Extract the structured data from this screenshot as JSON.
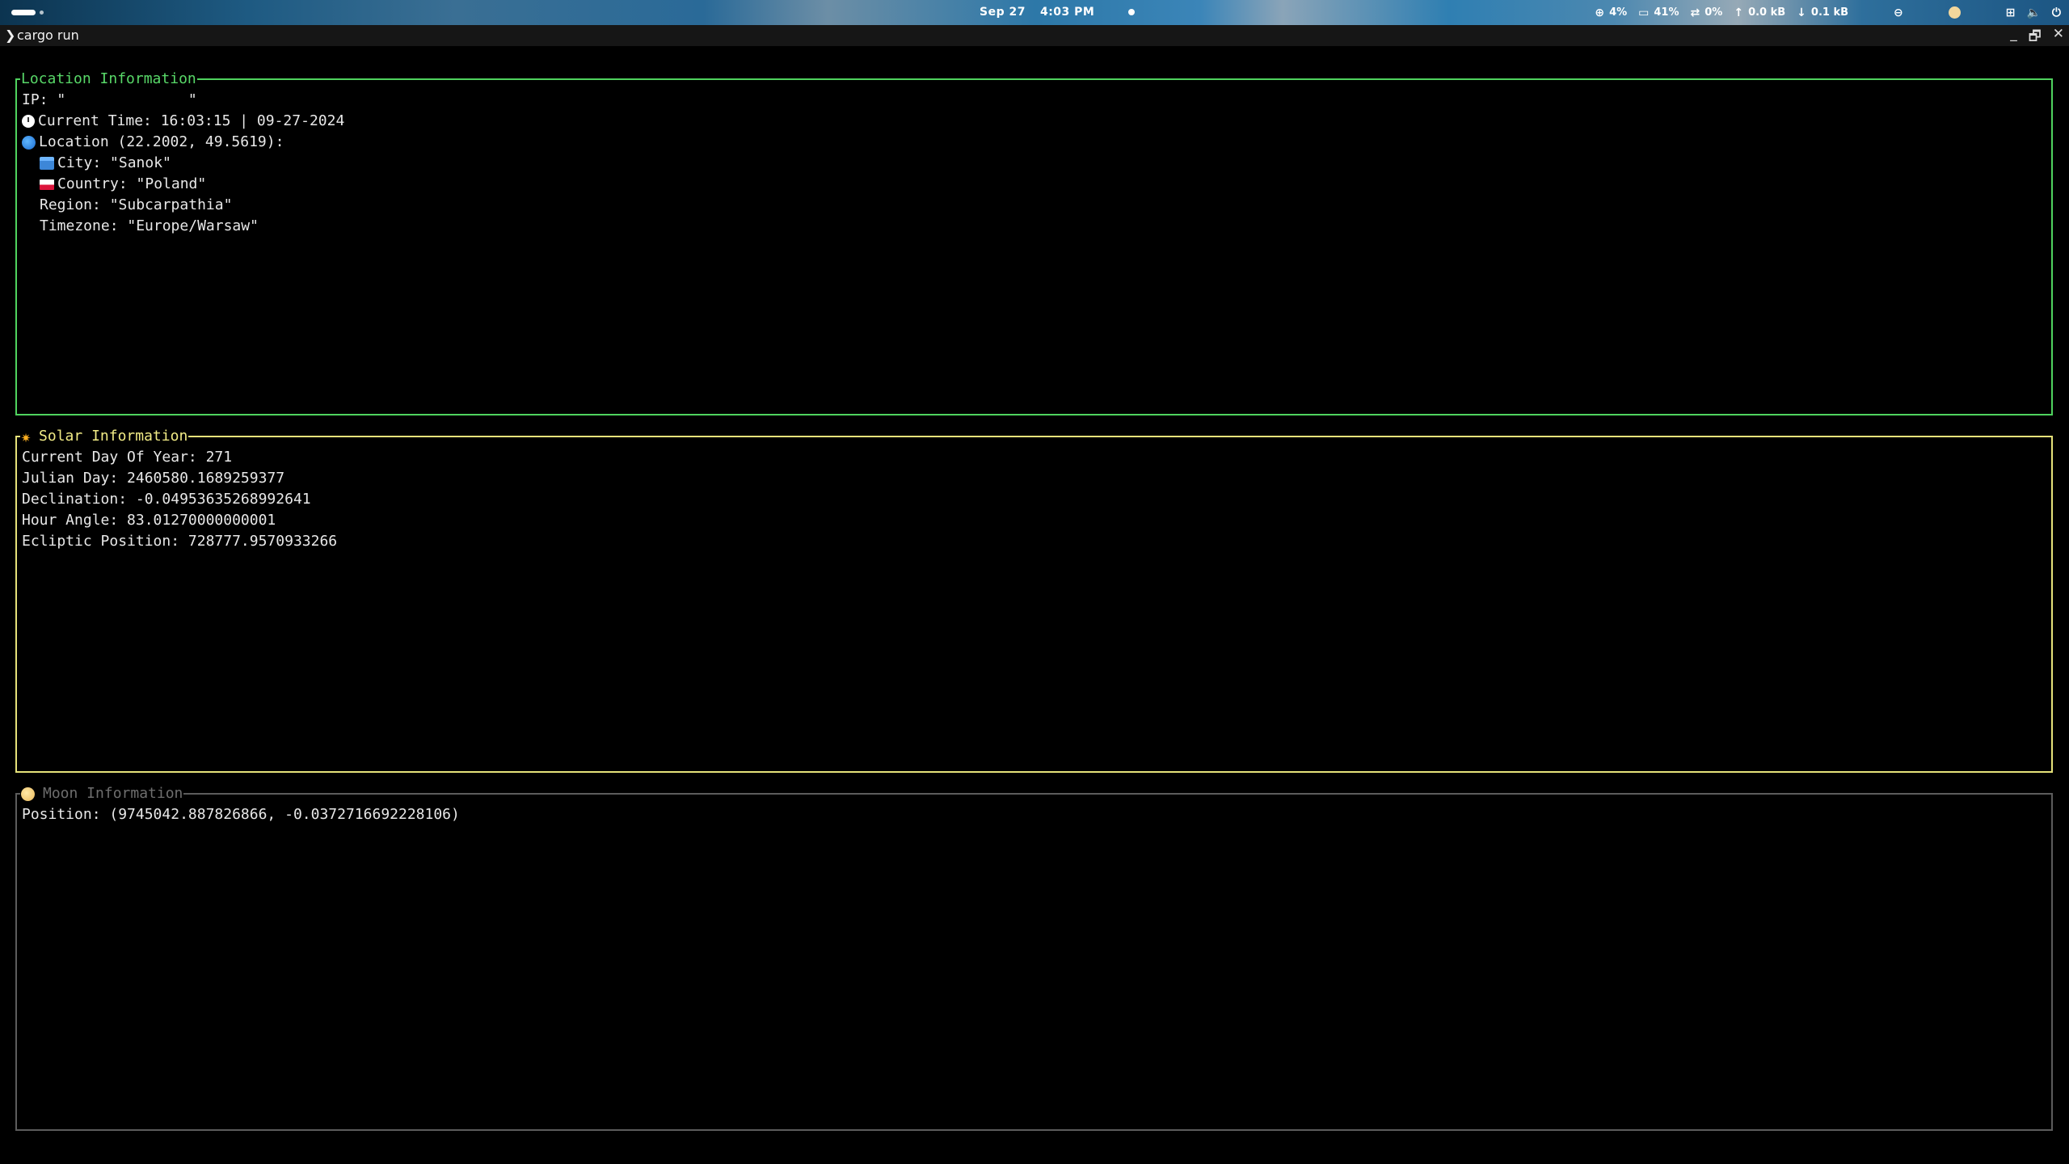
{
  "topbar": {
    "date": "Sep 27",
    "time": "4:03 PM",
    "cpu": "4%",
    "memory": "41%",
    "swap": "0%",
    "upload": "0.0 kB",
    "download": "0.1 kB"
  },
  "window": {
    "prompt": "❯",
    "title": "cargo run",
    "minimize": "_",
    "maximize": "🗗",
    "close": "✕"
  },
  "location": {
    "title": "Location Information",
    "ip": "IP: \"              \"",
    "current_time": "Current Time: 16:03:15 | 09-27-2024",
    "coords": "Location (22.2002, 49.5619):",
    "city": "City: \"Sanok\"",
    "country": "Country: \"Poland\"",
    "region": "Region: \"Subcarpathia\"",
    "timezone": "Timezone: \"Europe/Warsaw\""
  },
  "solar": {
    "title": "Solar Information",
    "day_of_year": "Current Day Of Year: 271",
    "julian_day": "Julian Day: 2460580.1689259377",
    "declination": "Declination: -0.04953635268992641",
    "hour_angle": "Hour Angle: 83.01270000000001",
    "ecliptic": "Ecliptic Position: 728777.9570933266"
  },
  "moon": {
    "title": "Moon Information",
    "position": "Position: (9745042.887826866, -0.0372716692228106)"
  },
  "colors": {
    "location_border": "#4fd35e",
    "solar_border": "#e6e27a",
    "moon_border": "#5c5c5c",
    "background": "#000000"
  }
}
